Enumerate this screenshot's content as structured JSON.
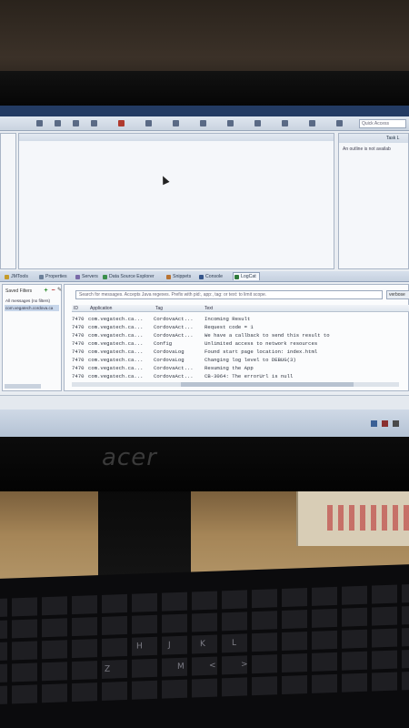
{
  "toolbar": {
    "quick_access_placeholder": "Quick Access"
  },
  "outline": {
    "tab_outline": "",
    "tab_task": "Task L",
    "message": "An outline is not availab"
  },
  "views": {
    "tabs": [
      {
        "label": "JMTools",
        "icon_color": "#c59b2a"
      },
      {
        "label": "Properties",
        "icon_color": "#6b7f99"
      },
      {
        "label": "Servers",
        "icon_color": "#7a6aa8"
      },
      {
        "label": "Data Source Explorer",
        "icon_color": "#3a8f4b"
      },
      {
        "label": "Snippets",
        "icon_color": "#b87333"
      },
      {
        "label": "Console",
        "icon_color": "#35558a"
      },
      {
        "label": "LogCat",
        "icon_color": "#2f7a3a"
      }
    ],
    "active_tab": "LogCat"
  },
  "filters": {
    "title": "Saved Filters",
    "add_icon": "plus-icon",
    "remove_icon": "minus-icon",
    "edit_icon": "edit-icon",
    "items": [
      "All messages (no filters)",
      "com.vegatech.cordova.ca"
    ],
    "selected": 1,
    "bottom_label": "savedFilters"
  },
  "logcat": {
    "search_placeholder": "Search for messages. Accepts Java regexes. Prefix with pid:, app:, tag: or text: to limit scope.",
    "level": "verbose",
    "columns": [
      "ID",
      "Application",
      "Tag",
      "Text"
    ],
    "rows": [
      {
        "id": "7470",
        "app": "com.vegatech.ca...",
        "tag": "CordovaAct...",
        "text": "Incoming Result"
      },
      {
        "id": "7470",
        "app": "com.vegatech.ca...",
        "tag": "CordovaAct...",
        "text": "Request code = 1"
      },
      {
        "id": "7470",
        "app": "com.vegatech.ca...",
        "tag": "CordovaAct...",
        "text": "We have a callback to send this result to"
      },
      {
        "id": "7470",
        "app": "com.vegatech.ca...",
        "tag": "Config",
        "text": "Unlimited access to network resources"
      },
      {
        "id": "7470",
        "app": "com.vegatech.ca...",
        "tag": "CordovaLog",
        "text": "Found start page location: index.html"
      },
      {
        "id": "7470",
        "app": "com.vegatech.ca...",
        "tag": "CordovaLog",
        "text": "Changing log level to DEBUG(3)"
      },
      {
        "id": "7470",
        "app": "com.vegatech.ca...",
        "tag": "CordovaAct...",
        "text": "Resuming the App"
      },
      {
        "id": "7470",
        "app": "com.vegatech.ca...",
        "tag": "CordovaAct...",
        "text": "CB-3064: The errorUrl is null"
      }
    ]
  },
  "monitor": {
    "brand": "acer"
  },
  "keyboard": {
    "keys": [
      "Z",
      "H",
      "J",
      "K",
      "L",
      "M",
      "<",
      ">"
    ]
  }
}
